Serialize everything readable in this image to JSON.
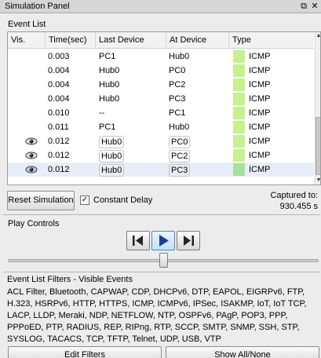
{
  "window": {
    "title": "Simulation Panel",
    "restore_glyph": "⧉",
    "close_glyph": "✕"
  },
  "event_list": {
    "label": "Event List",
    "columns": [
      "Vis.",
      "Time(sec)",
      "Last Device",
      "At Device",
      "Type"
    ],
    "rows": [
      {
        "vis": "",
        "time": "0.003",
        "last_device": "PC1",
        "at_device": "Hub0",
        "color": "#c8f08c",
        "type": "ICMP"
      },
      {
        "vis": "",
        "time": "0.004",
        "last_device": "Hub0",
        "at_device": "PC0",
        "color": "#c8f08c",
        "type": "ICMP"
      },
      {
        "vis": "",
        "time": "0.004",
        "last_device": "Hub0",
        "at_device": "PC2",
        "color": "#c8f08c",
        "type": "ICMP"
      },
      {
        "vis": "",
        "time": "0.004",
        "last_device": "Hub0",
        "at_device": "PC3",
        "color": "#c8f08c",
        "type": "ICMP"
      },
      {
        "vis": "",
        "time": "0.010",
        "last_device": "--",
        "at_device": "PC1",
        "color": "#c8f08c",
        "type": "ICMP"
      },
      {
        "vis": "",
        "time": "0.011",
        "last_device": "PC1",
        "at_device": "Hub0",
        "color": "#c8f08c",
        "type": "ICMP"
      },
      {
        "vis": "eye-icon",
        "time": "0.012",
        "last_device": "Hub0",
        "at_device": "PC0",
        "color": "#c8f08c",
        "type": "ICMP"
      },
      {
        "vis": "eye-icon",
        "time": "0.012",
        "last_device": "Hub0",
        "at_device": "PC2",
        "color": "#c8f08c",
        "type": "ICMP"
      },
      {
        "vis": "eye-icon-selected",
        "time": "0.012",
        "last_device": "Hub0",
        "at_device": "PC3",
        "color": "#a6e0a0",
        "type": "ICMP"
      }
    ]
  },
  "controls": {
    "reset_label": "Reset Simulation",
    "constant_delay_label": "Constant Delay",
    "constant_delay_checked": true,
    "checkmark": "✓",
    "captured_label": "Captured to:",
    "captured_value": "930.455 s"
  },
  "play_controls": {
    "label": "Play Controls",
    "buttons": [
      "back-icon",
      "play-icon",
      "forward-icon"
    ],
    "active_button": "play-icon"
  },
  "filters": {
    "label": "Event List Filters - Visible Events",
    "text": "ACL Filter, Bluetooth, CAPWAP, CDP, DHCPv6, DTP, EAPOL, EIGRPv6, FTP, H.323, HSRPv6, HTTP, HTTPS, ICMP, ICMPv6, IPSec, ISAKMP, IoT, IoT TCP, LACP, LLDP, Meraki, NDP, NETFLOW, NTP, OSPFv6, PAgP, POP3, PPP, PPPoED, PTP, RADIUS, REP, RIPng, RTP, SCCP, SMTP, SNMP, SSH, STP, SYSLOG, TACACS, TCP, TFTP, Telnet, UDP, USB, VTP",
    "edit_label": "Edit Filters",
    "show_label": "Show All/None"
  },
  "colors": {
    "icmp_swatch": "#c8f08c",
    "icmp_swatch_selected": "#a6e0a0",
    "selected_row": "#e8eef7"
  }
}
